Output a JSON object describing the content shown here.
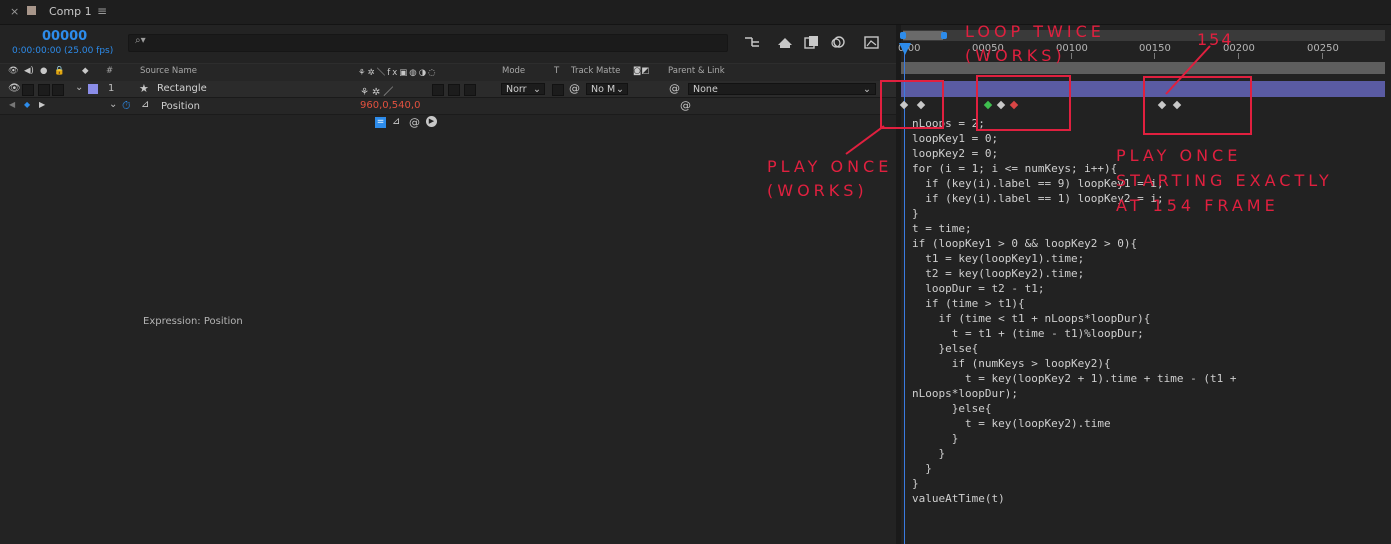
{
  "tab": {
    "close": "×",
    "title": "Comp 1",
    "menu": "≡"
  },
  "timecode": {
    "frame": "00000",
    "fps": "0:00:00:00 (25.00 fps)"
  },
  "search": {
    "icon": "⌕▾",
    "placeholder": ""
  },
  "columns": {
    "source_name": "Source Name",
    "num": "#",
    "mode": "Mode",
    "t": "T",
    "track_matte": "Track Matte",
    "parent_link": "Parent & Link"
  },
  "layer": {
    "number": "1",
    "name": "Rectangle",
    "mode": "Norr",
    "track_matte": "No M",
    "parent": "None",
    "label_color": "#8b8de8"
  },
  "property": {
    "name": "Position",
    "value": "960,0,540,0"
  },
  "expression_label": "Expression: Position",
  "ruler": [
    "0:00",
    "00050",
    "00100",
    "00150",
    "00200",
    "00250"
  ],
  "expression_code": "nLoops = 2;\nloopKey1 = 0;\nloopKey2 = 0;\nfor (i = 1; i <= numKeys; i++){\n  if (key(i).label == 9) loopKey1 = i;\n  if (key(i).label == 1) loopKey2 = i;\n}\nt = time;\nif (loopKey1 > 0 && loopKey2 > 0){\n  t1 = key(loopKey1).time;\n  t2 = key(loopKey2).time;\n  loopDur = t2 - t1;\n  if (time > t1){\n    if (time < t1 + nLoops*loopDur){\n      t = t1 + (time - t1)%loopDur;\n    }else{\n      if (numKeys > loopKey2){\n        t = key(loopKey2 + 1).time + time - (t1 +\nnLoops*loopDur);\n      }else{\n        t = key(loopKey2).time\n      }\n    }\n  }\n}\nvalueAtTime(t)",
  "annotations": {
    "loop_twice": "LOOP TWICE\n(WORKS)",
    "play_once_works": "PLAY ONCE\n(WORKS)",
    "frame_154": "154",
    "play_once_154": "PLAY ONCE\nSTARTING EXACTLY\nAT 154 FRAME"
  },
  "colors": {
    "accent_blue": "#2d8ceb",
    "annotation_red": "#e0203f",
    "layer_bar": "#5a5ba3",
    "keyframe_green": "#3fbf4f",
    "keyframe_red": "#d94545",
    "keyframe_gray": "#c8c8c8"
  },
  "keyframes": [
    {
      "frame": 0,
      "color": "gray"
    },
    {
      "frame": 10,
      "color": "gray"
    },
    {
      "frame": 50,
      "color": "green"
    },
    {
      "frame": 58,
      "color": "gray"
    },
    {
      "frame": 66,
      "color": "red"
    },
    {
      "frame": 154,
      "color": "gray"
    },
    {
      "frame": 163,
      "color": "gray"
    }
  ]
}
